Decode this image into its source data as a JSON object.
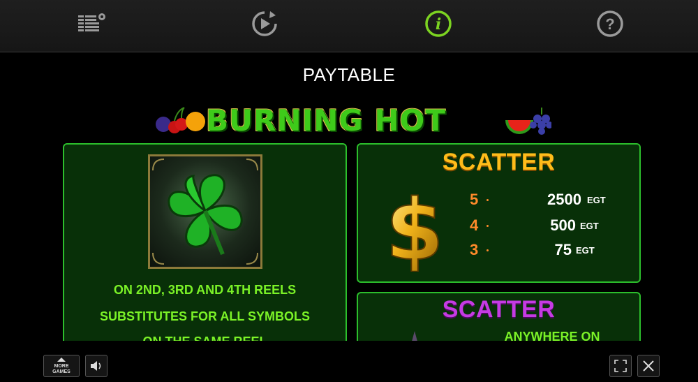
{
  "topbar": {
    "icons": [
      "settings-menu-icon",
      "autoplay-icon",
      "info-icon",
      "help-icon"
    ],
    "active_color": "#7cd321"
  },
  "page": {
    "title": "PAYTABLE"
  },
  "logo": {
    "text": "BURNING HOT"
  },
  "wild_panel": {
    "symbol": "four-leaf-clover",
    "lines": [
      "ON 2ND, 3RD AND 4TH REELS",
      "SUBSTITUTES FOR ALL SYMBOLS",
      "ON THE SAME REEL"
    ]
  },
  "scatter_dollar": {
    "title": "SCATTER",
    "symbol": "dollar-sign",
    "rows": [
      {
        "count": "5",
        "value": "2500",
        "unit": "EGT"
      },
      {
        "count": "4",
        "value": "500",
        "unit": "EGT"
      },
      {
        "count": "3",
        "value": "75",
        "unit": "EGT"
      }
    ]
  },
  "scatter_star": {
    "title": "SCATTER",
    "text": "ANYWHERE ON"
  },
  "bottombar": {
    "more_games_line1": "MORE",
    "more_games_line2": "GAMES"
  },
  "colors": {
    "panel_border": "#2cbf2c",
    "panel_bg": "#083008",
    "green_text": "#7bf227",
    "scatter_gold": "#ffbc1a",
    "scatter_purple": "#c53be3",
    "pay_count": "#ff8a2a"
  }
}
